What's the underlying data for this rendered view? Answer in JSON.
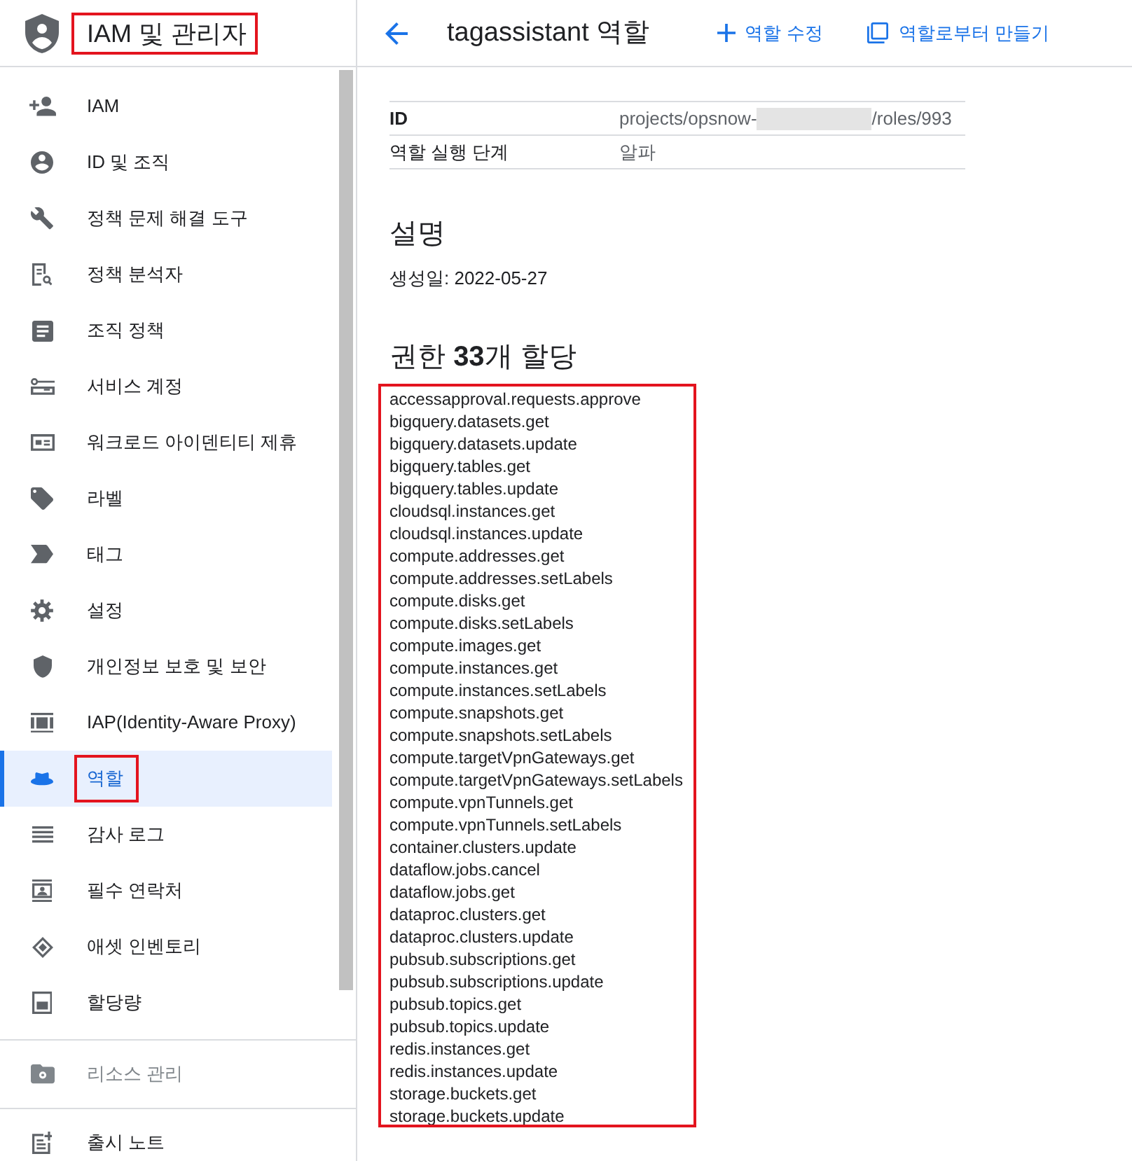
{
  "sidebar": {
    "title": "IAM 및 관리자",
    "title_highlighted": true,
    "groups": [
      {
        "items": [
          {
            "label": "IAM",
            "selected": false,
            "disabled": false,
            "highlighted": false
          },
          {
            "label": "ID 및 조직",
            "selected": false,
            "disabled": false,
            "highlighted": false
          },
          {
            "label": "정책 문제 해결 도구",
            "selected": false,
            "disabled": false,
            "highlighted": false
          },
          {
            "label": "정책 분석자",
            "selected": false,
            "disabled": false,
            "highlighted": false
          },
          {
            "label": "조직 정책",
            "selected": false,
            "disabled": false,
            "highlighted": false
          },
          {
            "label": "서비스 계정",
            "selected": false,
            "disabled": false,
            "highlighted": false
          },
          {
            "label": "워크로드 아이덴티티 제휴",
            "selected": false,
            "disabled": false,
            "highlighted": false
          },
          {
            "label": "라벨",
            "selected": false,
            "disabled": false,
            "highlighted": false
          },
          {
            "label": "태그",
            "selected": false,
            "disabled": false,
            "highlighted": false
          },
          {
            "label": "설정",
            "selected": false,
            "disabled": false,
            "highlighted": false
          },
          {
            "label": "개인정보 보호 및 보안",
            "selected": false,
            "disabled": false,
            "highlighted": false
          },
          {
            "label": "IAP(Identity-Aware Proxy)",
            "selected": false,
            "disabled": false,
            "highlighted": false
          },
          {
            "label": "역할",
            "selected": true,
            "disabled": false,
            "highlighted": true
          },
          {
            "label": "감사 로그",
            "selected": false,
            "disabled": false,
            "highlighted": false
          },
          {
            "label": "필수 연락처",
            "selected": false,
            "disabled": false,
            "highlighted": false
          },
          {
            "label": "애셋 인벤토리",
            "selected": false,
            "disabled": false,
            "highlighted": false
          },
          {
            "label": "할당량",
            "selected": false,
            "disabled": false,
            "highlighted": false
          }
        ]
      },
      {
        "items": [
          {
            "label": "리소스 관리",
            "selected": false,
            "disabled": true,
            "highlighted": false
          }
        ]
      },
      {
        "items": [
          {
            "label": "출시 노트",
            "selected": false,
            "disabled": false,
            "highlighted": false
          }
        ]
      }
    ]
  },
  "header": {
    "title": "tagassistant 역할",
    "actions": [
      {
        "label": "역할 수정"
      },
      {
        "label": "역할로부터 만들기"
      }
    ]
  },
  "details": [
    {
      "label": "ID",
      "bold": true,
      "value": "projects/opsnow-",
      "redacted": true,
      "value_after": "/roles/993"
    },
    {
      "label": "역할 실행 단계",
      "bold": false,
      "value": "알파"
    }
  ],
  "description": {
    "heading": "설명",
    "created": "생성일: 2022-05-27"
  },
  "permissions": {
    "heading": "권한 **33**개 할당",
    "highlighted": true,
    "items": [
      "accessapproval.requests.approve",
      "bigquery.datasets.get",
      "bigquery.datasets.update",
      "bigquery.tables.get",
      "bigquery.tables.update",
      "cloudsql.instances.get",
      "cloudsql.instances.update",
      "compute.addresses.get",
      "compute.addresses.setLabels",
      "compute.disks.get",
      "compute.disks.setLabels",
      "compute.images.get",
      "compute.instances.get",
      "compute.instances.setLabels",
      "compute.snapshots.get",
      "compute.snapshots.setLabels",
      "compute.targetVpnGateways.get",
      "compute.targetVpnGateways.setLabels",
      "compute.vpnTunnels.get",
      "compute.vpnTunnels.setLabels",
      "container.clusters.update",
      "dataflow.jobs.cancel",
      "dataflow.jobs.get",
      "dataproc.clusters.get",
      "dataproc.clusters.update",
      "pubsub.subscriptions.get",
      "pubsub.subscriptions.update",
      "pubsub.topics.get",
      "pubsub.topics.update",
      "redis.instances.get",
      "redis.instances.update",
      "storage.buckets.get",
      "storage.buckets.update"
    ]
  }
}
